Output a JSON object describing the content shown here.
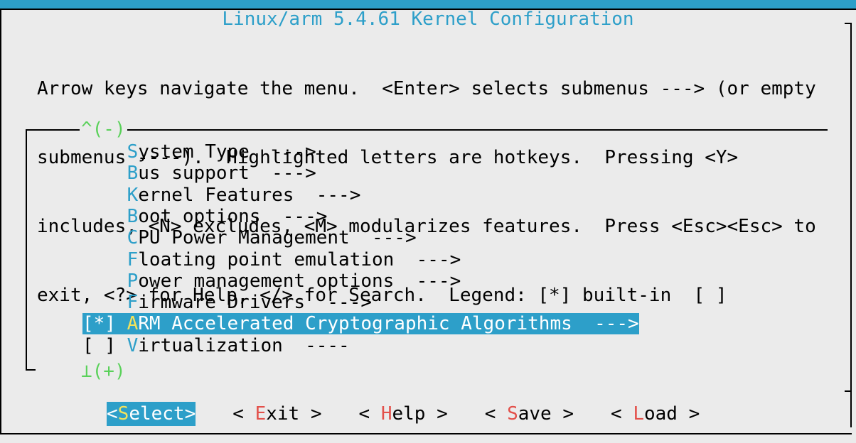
{
  "title": "Linux/arm 5.4.61 Kernel Configuration",
  "help_lines": [
    "Arrow keys navigate the menu.  <Enter> selects submenus ---> (or empty",
    "submenus ----).  Highlighted letters are hotkeys.  Pressing <Y>",
    "includes, <N> excludes, <M> modularizes features.  Press <Esc><Esc> to",
    "exit, <?> for Help, </> for Search.  Legend: [*] built-in  [ ]"
  ],
  "scroll_up": "^(-)",
  "scroll_down": "⊥(+)",
  "menu_items": [
    {
      "prefix": "    ",
      "hotkey": "S",
      "rest": "ystem Type  --->",
      "selected": false
    },
    {
      "prefix": "    ",
      "hotkey": "B",
      "rest": "us support  --->",
      "selected": false
    },
    {
      "prefix": "    ",
      "hotkey": "K",
      "rest": "ernel Features  --->",
      "selected": false
    },
    {
      "prefix": "    ",
      "hotkey": "B",
      "rest": "oot options  --->",
      "selected": false
    },
    {
      "prefix": "    ",
      "hotkey": "C",
      "rest": "PU Power Management  --->",
      "selected": false
    },
    {
      "prefix": "    ",
      "hotkey": "F",
      "rest": "loating point emulation  --->",
      "selected": false
    },
    {
      "prefix": "    ",
      "hotkey": "P",
      "rest": "ower management options  --->",
      "selected": false
    },
    {
      "prefix": "    ",
      "hotkey": "F",
      "rest": "irmware Drivers  --->",
      "selected": false
    },
    {
      "prefix": "[*] ",
      "hotkey": "A",
      "rest": "RM Accelerated Cryptographic Algorithms  --->",
      "selected": true
    },
    {
      "prefix": "[ ] ",
      "hotkey": "V",
      "rest": "irtualization  ----",
      "selected": false
    }
  ],
  "buttons": [
    {
      "left": "<",
      "hotkey": "S",
      "rest": "elect",
      "right": ">",
      "selected": true
    },
    {
      "left": "< ",
      "hotkey": "E",
      "rest": "xit",
      "right": " >",
      "selected": false
    },
    {
      "left": "< ",
      "hotkey": "H",
      "rest": "elp",
      "right": " >",
      "selected": false
    },
    {
      "left": "< ",
      "hotkey": "S",
      "rest": "ave",
      "right": " >",
      "selected": false
    },
    {
      "left": "< ",
      "hotkey": "L",
      "rest": "oad",
      "right": " >",
      "selected": false
    }
  ],
  "colors": {
    "accent": "#2d9fc9",
    "hotkey_selected": "#f5e35a",
    "hotkey_button": "#e3504a",
    "scroll_indicator": "#5ad15a"
  }
}
